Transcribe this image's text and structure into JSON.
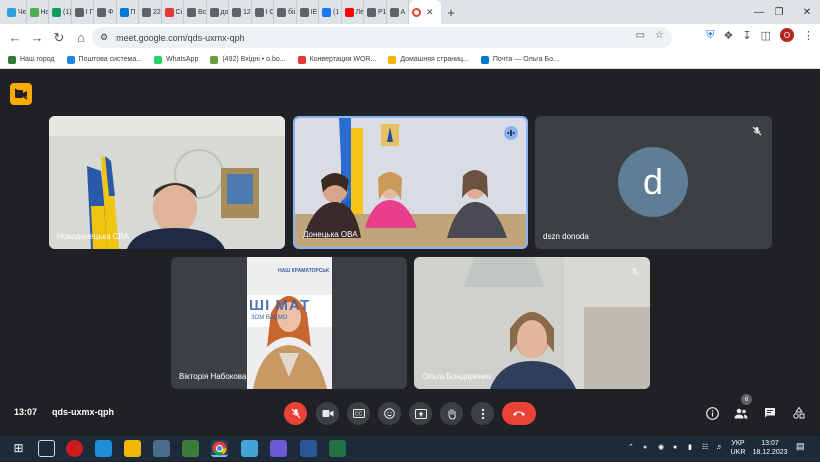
{
  "browser": {
    "tabs": [
      {
        "label": "Чє",
        "color": "#2aa1da"
      },
      {
        "label": "Нс",
        "color": "#4caf50"
      },
      {
        "label": "(1)",
        "color": "#0f9d58"
      },
      {
        "label": "І Г",
        "color": "#5f6368"
      },
      {
        "label": "Ф",
        "color": "#5f6368"
      },
      {
        "label": "П",
        "color": "#0078d4"
      },
      {
        "label": "22",
        "color": "#5f6368"
      },
      {
        "label": "Сі",
        "color": "#e53935"
      },
      {
        "label": "Вс",
        "color": "#5f6368"
      },
      {
        "label": "до",
        "color": "#5f6368"
      },
      {
        "label": "12",
        "color": "#5f6368"
      },
      {
        "label": "І С",
        "color": "#5f6368"
      },
      {
        "label": "біі",
        "color": "#5f6368"
      },
      {
        "label": "ІЕ",
        "color": "#5f6368"
      },
      {
        "label": "(1",
        "color": "#1877f2"
      },
      {
        "label": "Ле",
        "color": "#ff0000"
      },
      {
        "label": "Р1",
        "color": "#5f6368"
      },
      {
        "label": "А",
        "color": "#5f6368"
      }
    ],
    "active_tab_close": "✕",
    "new_tab": "+",
    "url": "meet.google.com/qds-uxmx-qph",
    "profile_initial": "О",
    "bookmarks": [
      {
        "label": "Наш город",
        "color": "#2e7d32"
      },
      {
        "label": "Поштова система...",
        "color": "#1e88e5"
      },
      {
        "label": "WhatsApp",
        "color": "#25d366"
      },
      {
        "label": "(492) Вхідні • о.bo...",
        "color": "#689f38"
      },
      {
        "label": "Конвертация WOR...",
        "color": "#e53935"
      },
      {
        "label": "Домашняя страниц...",
        "color": "#f4b400"
      },
      {
        "label": "Почта — Ольга Бо...",
        "color": "#0078d4"
      }
    ]
  },
  "meet": {
    "participants": [
      {
        "name": "Новодонецька СВА",
        "muted": false,
        "speaking": false
      },
      {
        "name": "Донецька ОВА",
        "muted": false,
        "speaking": true
      },
      {
        "name": "dszn donoda",
        "muted": true,
        "speaking": false,
        "avatar_letter": "d"
      },
      {
        "name": "Вікторія Набокова",
        "muted": false,
        "speaking": false
      },
      {
        "name": "Ольга Бондаренко",
        "muted": true,
        "speaking": false
      }
    ],
    "poster_text": {
      "line1": "НАШ КРАМАТОРСЬК",
      "big": "ШІ МАТ",
      "small": "ЗОМ  ВАЕМО"
    },
    "time": "13:07",
    "meeting_code": "qds-uxmx-qph",
    "people_count": "6"
  },
  "taskbar": {
    "lang_top": "УКР",
    "lang_bottom": "UKR",
    "time": "13:07",
    "date": "18.12.2023"
  }
}
